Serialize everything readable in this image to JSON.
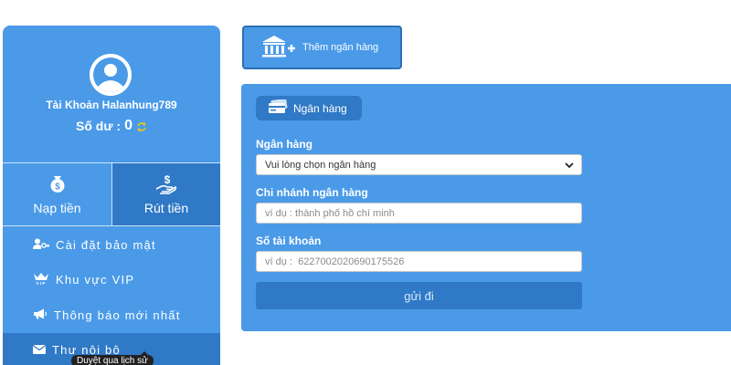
{
  "sidebar": {
    "account_name": "Tài Khoản Halanhung789",
    "balance_label": "Số dư :",
    "balance_value": "0",
    "deposit_label": "Nạp tiền",
    "withdraw_label": "Rút tiền",
    "menu": [
      {
        "label": "Cài đặt bảo mật",
        "icon": "user-key-icon"
      },
      {
        "label": "Khu vực VIP",
        "icon": "vip-crown-icon"
      },
      {
        "label": "Thông báo mới nhất",
        "icon": "megaphone-icon"
      },
      {
        "label": "Thư nội bộ",
        "icon": "envelope-icon"
      }
    ],
    "tooltip": "Duyệt qua lịch sử"
  },
  "main": {
    "add_bank_label": "Thêm ngân hàng",
    "panel_tab_label": "Ngân hàng",
    "bank_label": "Ngân hàng",
    "bank_select_value": "Vui lòng chọn ngân hàng",
    "branch_label": "Chi nhánh ngân hàng",
    "branch_placeholder": "ví dụ : thành phố hồ chí minh",
    "account_label": "Số tài khoản",
    "account_placeholder": "ví dụ :  6227002020690175526",
    "submit_label": "gửi đi"
  },
  "colors": {
    "primary": "#4a9ae8",
    "primary_dark": "#2f79c6",
    "refresh_icon": "#f0c419"
  }
}
